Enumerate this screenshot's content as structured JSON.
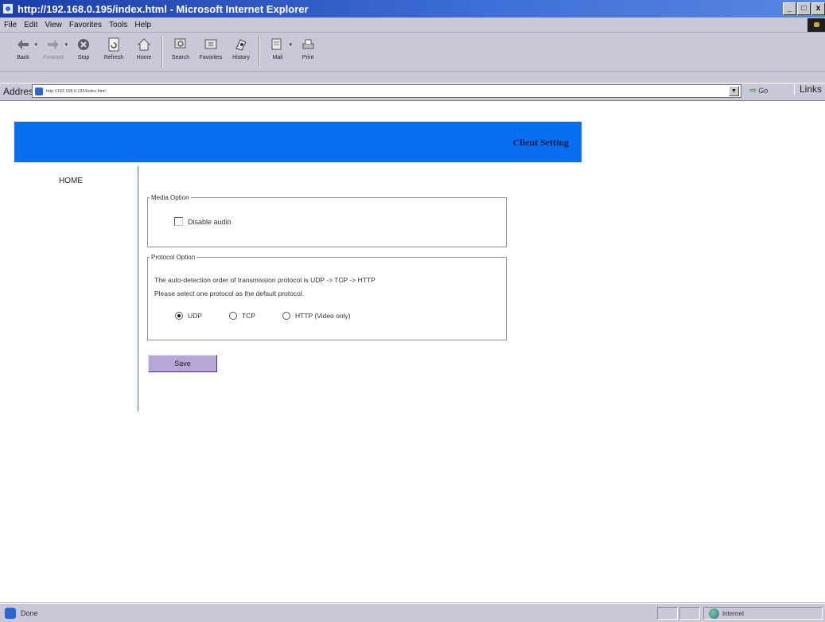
{
  "window": {
    "title": "http://192.168.0.195/index.html - Microsoft Internet Explorer",
    "buttons": [
      "_",
      "□",
      "x"
    ]
  },
  "menu": [
    "File",
    "Edit",
    "View",
    "Favorites",
    "Tools",
    "Help"
  ],
  "toolbar": {
    "buttons": [
      {
        "label": "Back",
        "icon": "back-arrow-icon"
      },
      {
        "label": "Forward",
        "icon": "forward-arrow-icon"
      },
      {
        "label": "Stop",
        "icon": "stop-icon"
      },
      {
        "label": "Refresh",
        "icon": "refresh-icon"
      },
      {
        "label": "Home",
        "icon": "home-icon"
      },
      {
        "label": "Search",
        "icon": "search-icon"
      },
      {
        "label": "Favorites",
        "icon": "favorites-icon"
      },
      {
        "label": "History",
        "icon": "history-icon"
      },
      {
        "label": "Mail",
        "icon": "mail-icon"
      },
      {
        "label": "Print",
        "icon": "print-icon"
      }
    ]
  },
  "address": {
    "label": "Address",
    "url": "http://192.168.0.195/index.html",
    "go_label": "Go",
    "links_label": "Links"
  },
  "page": {
    "banner_title": "Client Setting",
    "home_link": "HOME",
    "media_option": {
      "legend": "Media Option",
      "disable_audio_label": "Disable audio",
      "disable_audio_checked": false
    },
    "protocol_option": {
      "legend": "Protocol Option",
      "line1": "The auto-detection order of transmission protocol is UDP -> TCP -> HTTP",
      "line2": "Please select one protocol as the default protocol.",
      "options": [
        {
          "label": "UDP",
          "selected": true
        },
        {
          "label": "TCP",
          "selected": false
        },
        {
          "label": "HTTP (Video only)",
          "selected": false
        }
      ]
    },
    "save_label": "Save"
  },
  "status": {
    "text": "Done",
    "zone": "Internet"
  },
  "colors": {
    "banner": "#0a6ef2",
    "title_bar": "#1c3ea8",
    "save_button": "#b8a6d8",
    "divider_line": "#2f8a7a"
  }
}
